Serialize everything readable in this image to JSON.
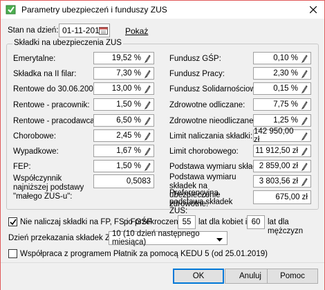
{
  "window": {
    "title": "Parametry ubezpieczeń i funduszy ZUS"
  },
  "date": {
    "label": "Stan na dzień:",
    "value": "01-11-2019",
    "show_link": "Pokaż"
  },
  "group": {
    "title": "Składki na ubezpieczenia ZUS",
    "left": [
      {
        "label": "Emerytalne:",
        "value": "19,52 %"
      },
      {
        "label": "Składka na II filar:",
        "value": "7,30 %"
      },
      {
        "label": "Rentowe do 30.06.2007:",
        "value": "13,00 %"
      },
      {
        "label": "Rentowe - pracownik:",
        "value": "1,50 %"
      },
      {
        "label": "Rentowe - pracodawca:",
        "value": "6,50 %"
      },
      {
        "label": "Chorobowe:",
        "value": "2,45 %"
      },
      {
        "label": "Wypadkowe:",
        "value": "1,67 %"
      },
      {
        "label": "FEP:",
        "value": "1,50 %"
      },
      {
        "label": "Współczynnik najniższej podstawy \"małego ZUS-u\":",
        "value": "0,5083"
      }
    ],
    "right": [
      {
        "label": "Fundusz GŚP:",
        "value": "0,10 %"
      },
      {
        "label": "Fundusz Pracy:",
        "value": "2,30 %"
      },
      {
        "label": "Fundusz Solidarnościowy",
        "value": "0,15 %"
      },
      {
        "label": "Zdrowotne odliczane:",
        "value": "7,75 %"
      },
      {
        "label": "Zdrowotne nieodliczane:",
        "value": "1,25 %"
      },
      {
        "label": "Limit naliczania składki:",
        "value": "142 950,00 zł"
      },
      {
        "label": "Limit chorobowego:",
        "value": "11 912,50 zł"
      },
      {
        "label": "Podstawa wymiaru składek:",
        "value": "2 859,00 zł"
      },
      {
        "label": "Podstawa wymiaru składek na ubezpieczenie zdrowotne:",
        "value": "3 803,56 zł"
      },
      {
        "label": "Preferencyjna podstawa składek ZUS:",
        "value": "675,00 zł"
      }
    ]
  },
  "no_contrib": {
    "checked": true,
    "label": "Nie naliczaj składki na FP, FS i FGŚP",
    "after_label": "po przekroczeniu",
    "women_age": "55",
    "women_suffix": "lat dla kobiet i",
    "men_age": "60",
    "men_suffix": "lat dla mężczyzn"
  },
  "transfer_day": {
    "label": "Dzień przekazania składek ZUS:",
    "value": "10 (10 dzień następnego miesiąca)"
  },
  "kedu": {
    "checked": false,
    "label": "Współpraca z programem Płatnik za pomocą KEDU 5 (od 25.01.2019)"
  },
  "buttons": {
    "ok": "OK",
    "cancel": "Anuluj",
    "help": "Pomoc"
  }
}
